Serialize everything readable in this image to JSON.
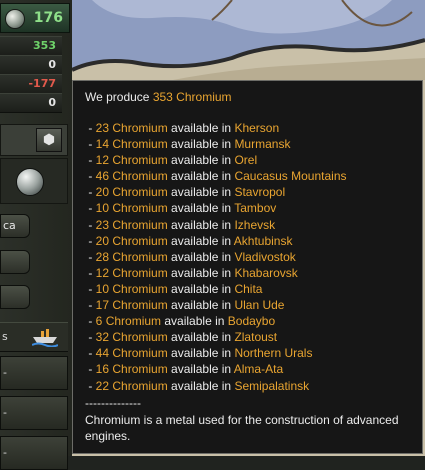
{
  "left_panel": {
    "coin_value": "176",
    "resource_values": [
      "353",
      "0",
      "-177",
      "0"
    ],
    "side_button_label": "ca",
    "ship_row_label": "s",
    "lower_item_labels": [
      "-",
      "-",
      "-"
    ]
  },
  "tooltip": {
    "header_prefix": "We produce ",
    "header_amount": "353 Chromium",
    "resource_name": "Chromium",
    "mid_text": " available in ",
    "entries": [
      {
        "amount": "23",
        "location": "Kherson"
      },
      {
        "amount": "14",
        "location": "Murmansk"
      },
      {
        "amount": "12",
        "location": "Orel"
      },
      {
        "amount": "46",
        "location": "Caucasus Mountains"
      },
      {
        "amount": "20",
        "location": "Stavropol"
      },
      {
        "amount": "10",
        "location": "Tambov"
      },
      {
        "amount": "23",
        "location": "Izhevsk"
      },
      {
        "amount": "20",
        "location": "Akhtubinsk"
      },
      {
        "amount": "28",
        "location": "Vladivostok"
      },
      {
        "amount": "12",
        "location": "Khabarovsk"
      },
      {
        "amount": "10",
        "location": "Chita"
      },
      {
        "amount": "17",
        "location": "Ulan Ude"
      },
      {
        "amount": "6",
        "location": "Bodaybo"
      },
      {
        "amount": "32",
        "location": "Zlatoust"
      },
      {
        "amount": "44",
        "location": "Northern Urals"
      },
      {
        "amount": "16",
        "location": "Alma-Ata"
      },
      {
        "amount": "22",
        "location": "Semipalatinsk"
      }
    ],
    "separator": "--------------",
    "description": "Chromium is a metal used for the construction of advanced engines."
  },
  "colors": {
    "highlight": "#e9a531",
    "tooltip_bg": "#161616",
    "tooltip_text": "#ececec",
    "positive": "#6fd36a",
    "negative": "#e25a4c"
  },
  "icons": [
    "coin-icon",
    "hexagon-icon",
    "sphere-icon",
    "ship-icon"
  ]
}
